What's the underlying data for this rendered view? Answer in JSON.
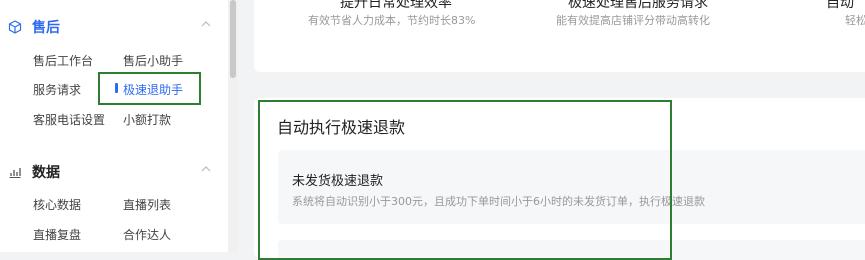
{
  "sidebar": {
    "groups": [
      {
        "icon": "cube-icon",
        "label": "售后",
        "items": [
          {
            "label": "售后工作台"
          },
          {
            "label": "售后小助手"
          },
          {
            "label": "服务请求"
          },
          {
            "label": "极速退助手"
          },
          {
            "label": "客服电话设置"
          },
          {
            "label": "小额打款"
          }
        ]
      },
      {
        "icon": "chart-icon",
        "label": "数据",
        "items": [
          {
            "label": "核心数据"
          },
          {
            "label": "直播列表"
          },
          {
            "label": "直播复盘"
          },
          {
            "label": "合作达人"
          }
        ]
      }
    ]
  },
  "features": [
    {
      "title": "提升日常处理效率",
      "desc": "有效节省人力成本，节约时长83%"
    },
    {
      "title": "极速处理售后服务请求",
      "desc": "能有效提高店铺评分带动高转化"
    },
    {
      "title": "自动",
      "desc": "轻松"
    }
  ],
  "main": {
    "section_title": "自动执行极速退款",
    "options": [
      {
        "title": "未发货极速退款",
        "desc": "系统将自动识别小于300元，且成功下单时间小于6小时的未发货订单，执行极速退款"
      }
    ]
  },
  "colors": {
    "accent": "#2e6bf0",
    "highlight_border": "#2f7d32"
  }
}
